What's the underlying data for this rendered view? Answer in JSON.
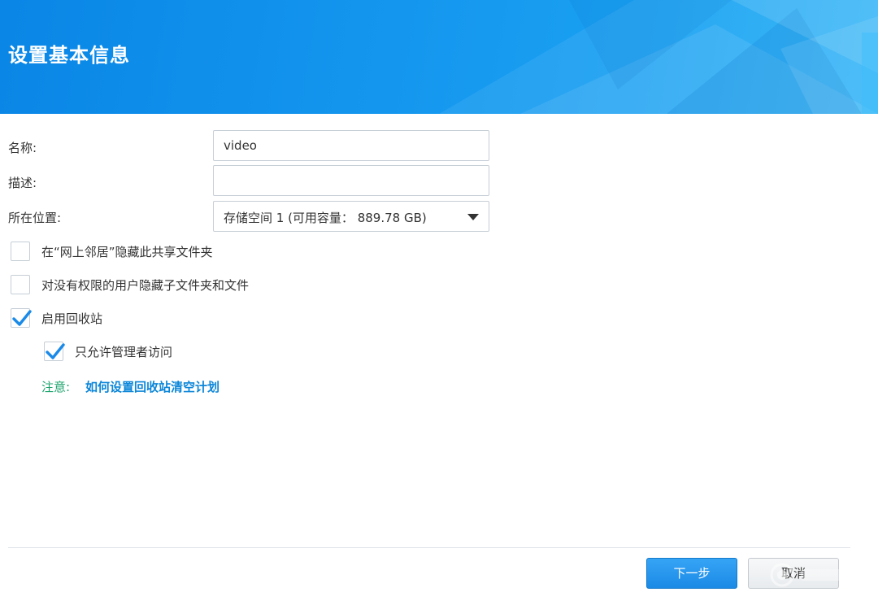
{
  "header": {
    "title": "设置基本信息"
  },
  "form": {
    "name": {
      "label": "名称:",
      "value": "video"
    },
    "description": {
      "label": "描述:",
      "value": ""
    },
    "location": {
      "label": "所在位置:",
      "selected": "存储空间 1 (可用容量： 889.78 GB)"
    }
  },
  "options": [
    {
      "label": "在“网上邻居”隐藏此共享文件夹",
      "checked": false
    },
    {
      "label": "对没有权限的用户隐藏子文件夹和文件",
      "checked": false
    },
    {
      "label": "启用回收站",
      "checked": true
    },
    {
      "label": "只允许管理者访问",
      "checked": true
    }
  ],
  "note": {
    "label": "注意:",
    "link": "如何设置回收站清空计划"
  },
  "buttons": {
    "next": "下一步",
    "cancel": "取消"
  },
  "colors": {
    "header_blue": "#1496ee",
    "accent_blue": "#1b8ae6",
    "note_green": "#1aa26b",
    "link_blue": "#0c86d8",
    "check_blue": "#1a8ae8"
  },
  "icons": {
    "checkmark": "check-icon",
    "dropdown": "caret-down-icon"
  }
}
